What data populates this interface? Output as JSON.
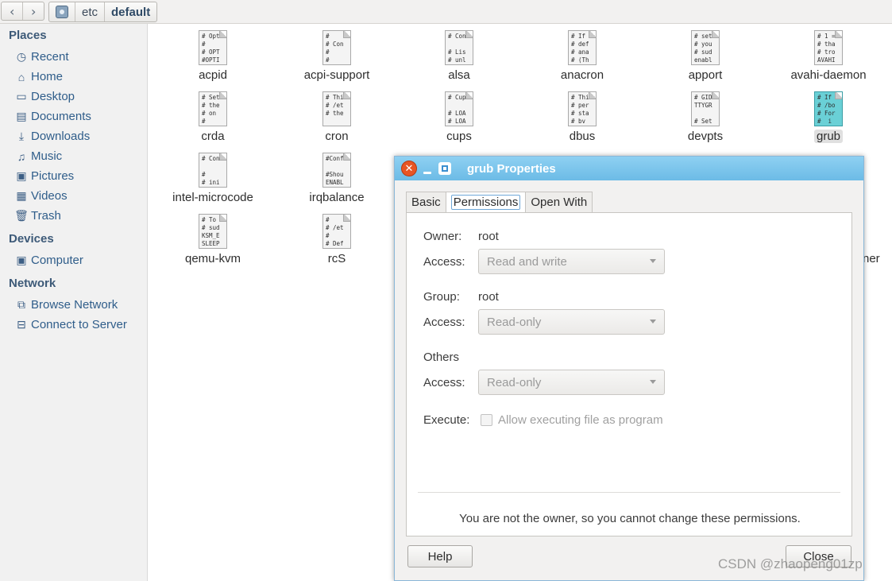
{
  "path": {
    "segments": [
      "etc",
      "default"
    ],
    "back_icon": "chevron-left-icon",
    "forward_icon": "chevron-right-icon"
  },
  "sidebar": {
    "places_heading": "Places",
    "places": [
      {
        "label": "Recent",
        "icon": "clock-icon"
      },
      {
        "label": "Home",
        "icon": "home-icon"
      },
      {
        "label": "Desktop",
        "icon": "desktop-icon"
      },
      {
        "label": "Documents",
        "icon": "documents-icon"
      },
      {
        "label": "Downloads",
        "icon": "download-icon"
      },
      {
        "label": "Music",
        "icon": "music-icon"
      },
      {
        "label": "Pictures",
        "icon": "pictures-icon"
      },
      {
        "label": "Videos",
        "icon": "videos-icon"
      },
      {
        "label": "Trash",
        "icon": "trash-icon"
      }
    ],
    "devices_heading": "Devices",
    "devices": [
      {
        "label": "Computer",
        "icon": "computer-icon"
      }
    ],
    "network_heading": "Network",
    "network": [
      {
        "label": "Browse Network",
        "icon": "network-icon"
      },
      {
        "label": "Connect to Server",
        "icon": "server-icon"
      }
    ]
  },
  "files": [
    {
      "name": "acpid",
      "preview": "# Opt\n#\n# OPT\n#OPTI"
    },
    {
      "name": "acpi-support",
      "preview": "#\n# Con\n#\n#"
    },
    {
      "name": "alsa",
      "preview": "# Con\n\n# Lis\n# unl"
    },
    {
      "name": "anacron",
      "preview": "# If\n# def\n# ana\n# (Th"
    },
    {
      "name": "apport",
      "preview": "# set\n# you\n# sud\nenabl"
    },
    {
      "name": "avahi-daemon",
      "preview": "# 1 =\n# tha\n# tro\nAVAHI"
    },
    {
      "name": "crda",
      "preview": "# Set\n# the\n# on\n#"
    },
    {
      "name": "cron",
      "preview": "# Thi\n# /et\n# the\n"
    },
    {
      "name": "cups",
      "preview": "# Cup\n\n# LOA\n# LOA"
    },
    {
      "name": "dbus",
      "preview": "# Thi\n# per\n# sta\n# bv"
    },
    {
      "name": "devpts",
      "preview": "# GID\nTTYGR\n\n# Set"
    },
    {
      "name": "grub",
      "preview": "# If\n# /bo\n# For\n#  i"
    },
    {
      "name": "intel-microcode",
      "preview": "# Con\n\n#\n# ini"
    },
    {
      "name": "irqbalance",
      "preview": "#Conf\n\n#Shou\nENABL"
    },
    {
      "name": "qemu-kvm",
      "preview": "# To\n# sud\nKSM_E\nSLEEP"
    },
    {
      "name": "rcS",
      "preview": "#\n# /et\n#\n# Def"
    }
  ],
  "partial_label": "ner",
  "dialog": {
    "title": "grub Properties",
    "tabs": [
      "Basic",
      "Permissions",
      "Open With"
    ],
    "owner_label": "Owner:",
    "owner_value": "root",
    "owner_access_label": "Access:",
    "owner_access": "Read and write",
    "group_label": "Group:",
    "group_value": "root",
    "group_access_label": "Access:",
    "group_access": "Read-only",
    "others_label": "Others",
    "others_access_label": "Access:",
    "others_access": "Read-only",
    "execute_label": "Execute:",
    "execute_checkbox": "Allow executing file as program",
    "notice": "You are not the owner, so you cannot change these permissions.",
    "help_button": "Help",
    "close_button": "Close"
  },
  "watermark": "CSDN @zhaopeng01zp"
}
